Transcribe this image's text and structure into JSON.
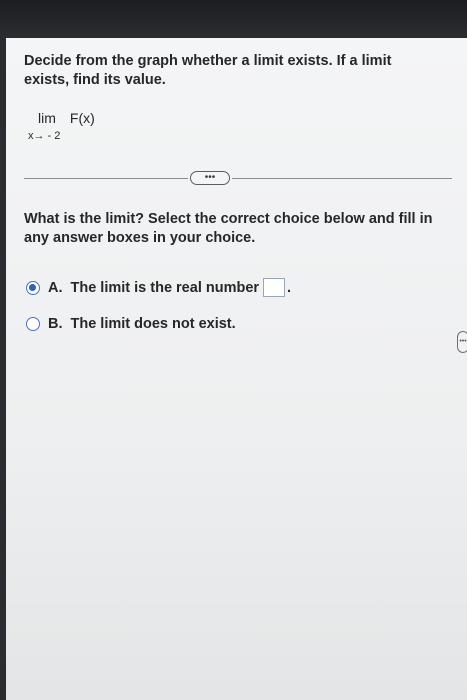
{
  "question": {
    "line1": "Decide from the graph whether a limit exists. If a limit",
    "line2": "exists, find its value."
  },
  "limit": {
    "word": "lim",
    "function": "F(x)",
    "subscript": "x→ - 2"
  },
  "more_button_label": "•••",
  "prompt": {
    "line1": "What is the limit? Select the correct choice below and fill in",
    "line2": "any answer boxes in your choice."
  },
  "choices": [
    {
      "letter": "A.",
      "text": "The limit is the real number",
      "selected": true,
      "suffix": "."
    },
    {
      "letter": "B.",
      "text": "The limit does not exist.",
      "selected": false
    }
  ],
  "answer_value": "",
  "scroll_handle_label": "•••",
  "colors": {
    "radio_accent": "#2f5fc0",
    "text": "#26272a",
    "background": "#f4f5f6"
  }
}
